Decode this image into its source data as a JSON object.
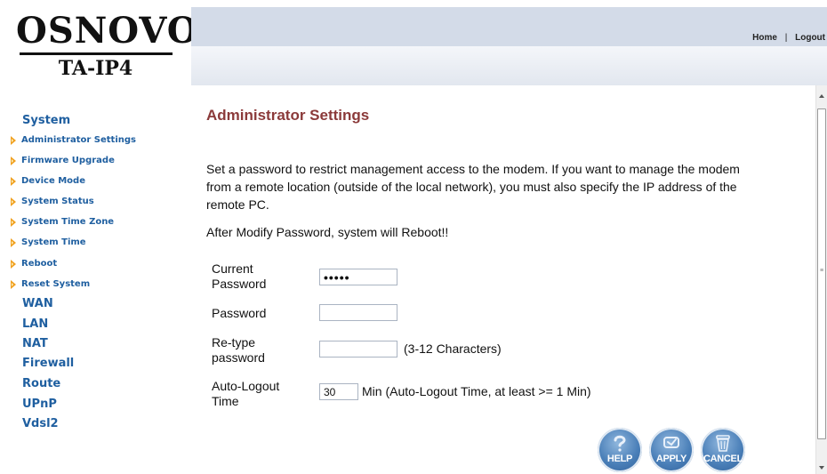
{
  "logo": {
    "brand": "OSNOVO",
    "model": "TA-IP4"
  },
  "top_nav": {
    "home": "Home",
    "separator": "|",
    "logout": "Logout"
  },
  "sidebar": {
    "system": "System",
    "system_items": [
      "Administrator Settings",
      "Firmware Upgrade",
      "Device Mode",
      "System Status",
      "System Time Zone",
      "System Time",
      "Reboot",
      "Reset System"
    ],
    "categories": [
      "WAN",
      "LAN",
      "NAT",
      "Firewall",
      "Route",
      "UPnP",
      "Vdsl2"
    ]
  },
  "page": {
    "title": "Administrator Settings",
    "description": "Set a password to restrict management access to the modem. If you want to manage the modem from a remote location (outside of the local network), you must also specify the IP address of the remote PC.",
    "warning": "After Modify Password, system will Reboot!!"
  },
  "form": {
    "current_password_label": "Current Password",
    "current_password_value": "•••••",
    "password_label": "Password",
    "password_value": "",
    "retype_label": "Re-type password",
    "retype_value": "",
    "retype_hint": "(3-12 Characters)",
    "autologout_label": "Auto-Logout Time",
    "autologout_value": "30",
    "autologout_hint": "Min (Auto-Logout Time, at least >= 1 Min)"
  },
  "buttons": {
    "help": "HELP",
    "apply": "APPLY",
    "cancel": "CANCEL"
  },
  "colors": {
    "title": "#8b3a3a",
    "nav_link": "#1f5fa0",
    "arrow_bullet": "#f0a020",
    "top_bar": "#d3dbe8",
    "round_button": "#4a7fb8"
  },
  "icons": {
    "bullet": "orange-triangle-icon",
    "help": "question-mark-icon",
    "apply": "apply-icon",
    "cancel": "trash-can-icon"
  }
}
